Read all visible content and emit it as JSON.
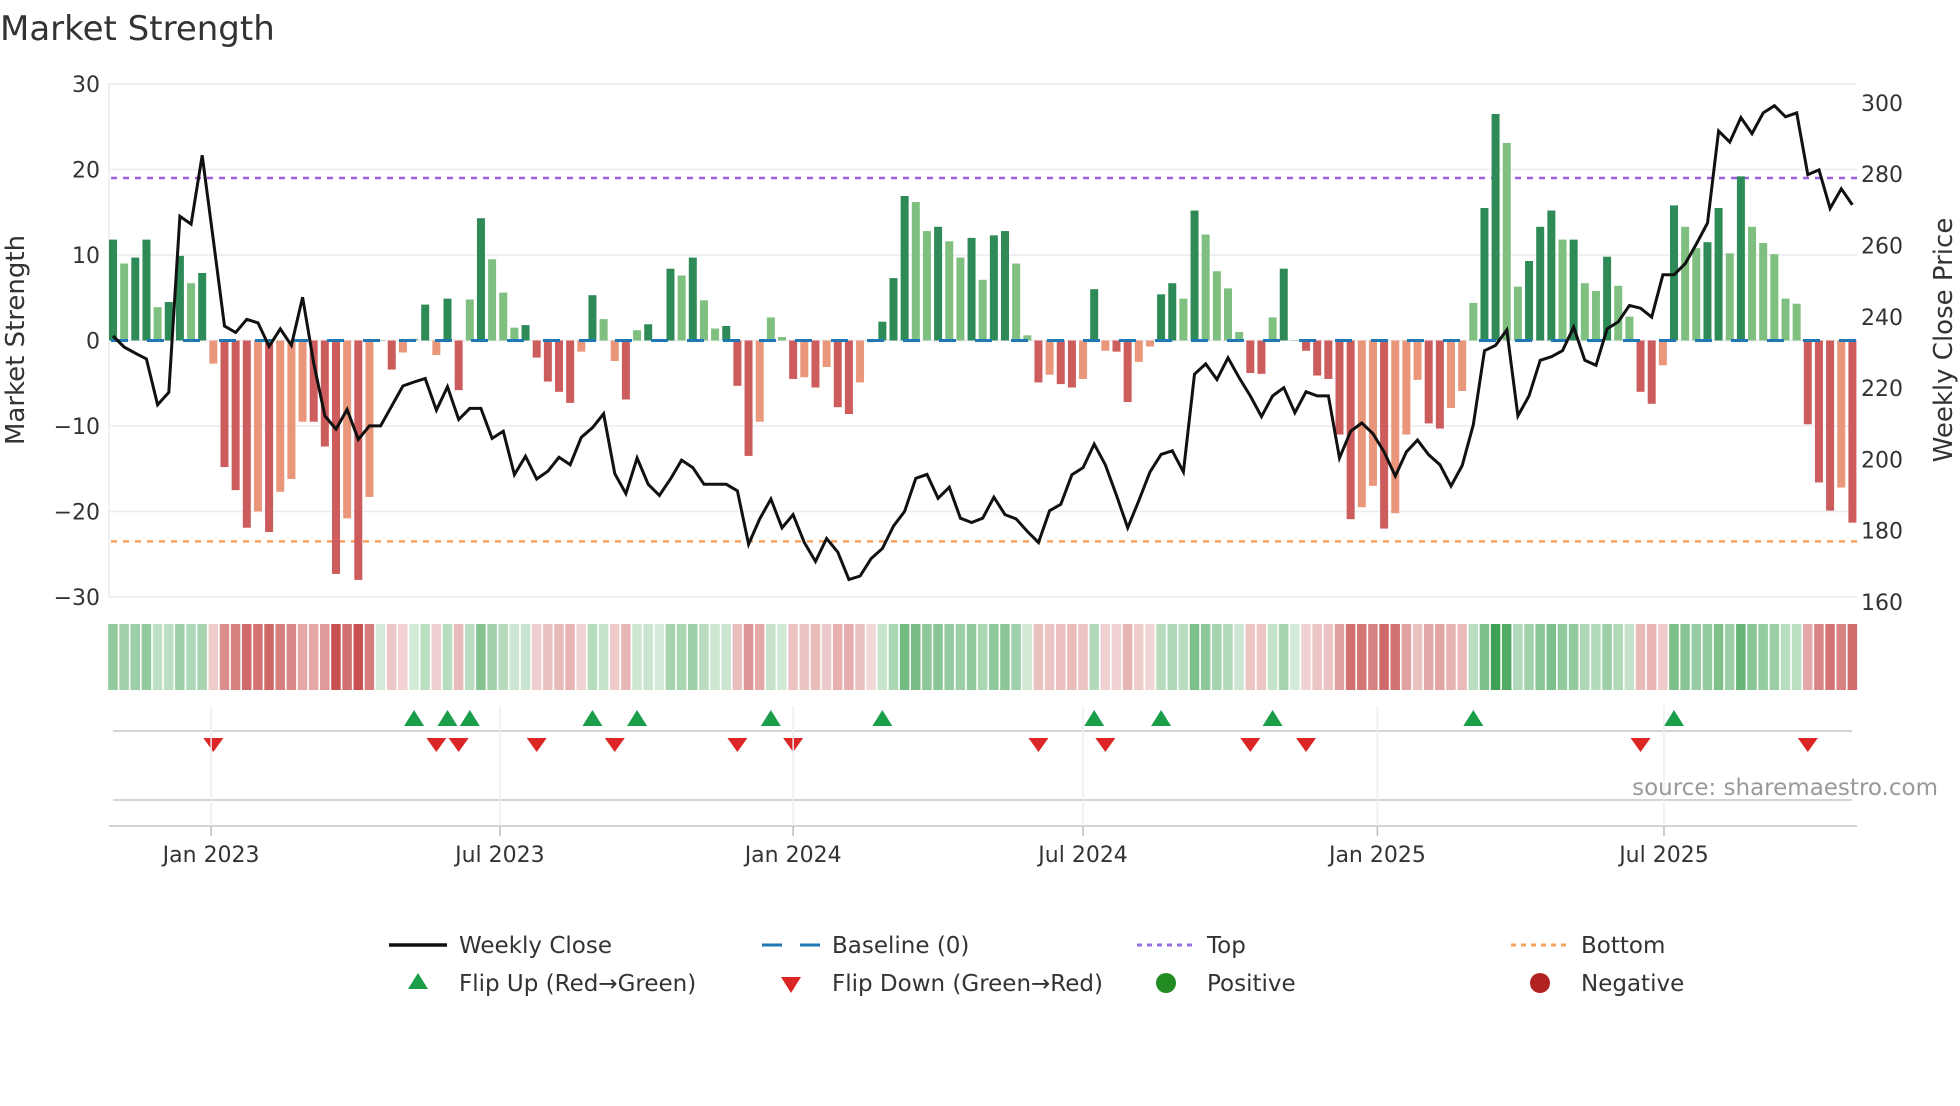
{
  "chart_data": {
    "type": "bar",
    "title": "Market Strength",
    "left_axis": {
      "label": "Market Strength",
      "range": [
        -30,
        30
      ],
      "ticks": [
        30,
        20,
        10,
        0,
        -10,
        -20,
        -30
      ],
      "tick_labels": [
        "30",
        "20",
        "10",
        "0",
        "−10",
        "−20",
        "−30"
      ]
    },
    "right_axis": {
      "label": "Weekly Close Price",
      "range": [
        161.4,
        305.3
      ],
      "ticks": [
        300,
        280,
        260,
        240,
        220,
        200,
        180,
        160
      ],
      "tick_labels": [
        "300",
        "280",
        "260",
        "240",
        "220",
        "200",
        "180",
        "160"
      ]
    },
    "x_ticks": [
      {
        "label": "Jan 2023",
        "week": 8.8
      },
      {
        "label": "Jul 2023",
        "week": 34.7
      },
      {
        "label": "Jan 2024",
        "week": 61.0
      },
      {
        "label": "Jul 2024",
        "week": 87.0
      },
      {
        "label": "Jan 2025",
        "week": 113.4
      },
      {
        "label": "Jul 2025",
        "week": 139.1
      }
    ],
    "top_level": 19,
    "bottom_level": -23.5,
    "baseline": 0,
    "strength": [
      11.8,
      9,
      9.7,
      11.8,
      3.9,
      4.5,
      9.9,
      6.7,
      7.9,
      -2.7,
      -14.8,
      -17.5,
      -21.9,
      -20,
      -22.4,
      -17.7,
      -16.2,
      -9.5,
      -9.5,
      -12.4,
      -27.3,
      -20.8,
      -28,
      -18.3,
      0,
      -3.4,
      -1.4,
      0.2,
      4.2,
      -1.7,
      4.9,
      -5.8,
      4.8,
      14.3,
      9.5,
      5.6,
      1.5,
      1.8,
      -2,
      -4.8,
      -6,
      -7.3,
      -1.3,
      5.3,
      2.5,
      -2.4,
      -6.9,
      1.2,
      1.9,
      0,
      8.4,
      7.6,
      9.7,
      4.7,
      1.4,
      1.7,
      -5.3,
      -13.5,
      -9.5,
      2.7,
      0.4,
      -4.5,
      -4.3,
      -5.5,
      -3.1,
      -7.8,
      -8.6,
      -4.9,
      -0.2,
      2.2,
      7.3,
      16.9,
      16.2,
      12.8,
      13.3,
      11.6,
      9.7,
      12,
      7.1,
      12.3,
      12.8,
      9,
      0.6,
      -4.9,
      -4,
      -5.1,
      -5.5,
      -4.5,
      6,
      -1.2,
      -1.3,
      -7.2,
      -2.5,
      -0.7,
      5.4,
      6.7,
      4.9,
      15.2,
      12.4,
      8.1,
      6.1,
      1,
      -3.8,
      -3.9,
      2.7,
      8.4,
      0,
      -1.2,
      -4.1,
      -4.5,
      -11,
      -20.9,
      -19.5,
      -17,
      -22,
      -20.2,
      -11,
      -4.6,
      -9.7,
      -10.3,
      -7.9,
      -5.9,
      4.4,
      15.5,
      26.5,
      23.1,
      6.3,
      9.3,
      13.3,
      15.2,
      11.8,
      11.8,
      6.7,
      5.8,
      9.8,
      6.4,
      2.8,
      -6,
      -7.4,
      -2.9,
      15.8,
      13.3,
      10.8,
      11.5,
      15.5,
      10.2,
      19.2,
      13.3,
      11.4,
      10.1,
      4.9,
      4.3,
      -9.8,
      -16.6,
      -19.9,
      -17.2,
      -21.3
    ],
    "weekly_close": [
      234.6,
      231.5,
      229.8,
      228.2,
      215.3,
      218.8,
      268.2,
      266,
      285.3,
      261.4,
      237.4,
      235.6,
      239.3,
      238.3,
      231.7,
      236.6,
      232,
      245.5,
      227,
      212.2,
      208.5,
      214,
      205.6,
      209.4,
      209.4,
      215,
      220.6,
      221.7,
      222.7,
      213.8,
      220.4,
      211.2,
      214.3,
      214.3,
      205.9,
      207.9,
      195.7,
      200.9,
      194.5,
      196.7,
      200.6,
      198.5,
      206.2,
      208.9,
      212.8,
      196,
      190.4,
      200.4,
      193,
      189.9,
      194.5,
      199.8,
      197.7,
      193,
      193,
      193,
      191.2,
      176.2,
      183.3,
      188.9,
      180.8,
      184.5,
      176.7,
      171.4,
      177.8,
      174,
      166.3,
      167.3,
      172.2,
      175,
      181.3,
      185.4,
      194.7,
      195.8,
      189.1,
      192.2,
      183.5,
      182.3,
      183.5,
      189.4,
      184.5,
      183.3,
      179.8,
      176.7,
      185.6,
      187.4,
      195.7,
      197.7,
      204.3,
      198.5,
      189.9,
      180.8,
      188.4,
      196.5,
      201.4,
      202.4,
      196.5,
      223.9,
      226.8,
      222.4,
      228.5,
      222.9,
      217.8,
      212,
      217.8,
      220.1,
      213.1,
      219,
      217.8,
      217.8,
      200.4,
      207.9,
      210.2,
      207.2,
      202.1,
      195.3,
      202.1,
      205.4,
      201.3,
      198.5,
      192.5,
      198.3,
      209.7,
      230.5,
      232,
      236.3,
      212.2,
      217.8,
      227.8,
      228.8,
      230.5,
      237.1,
      227.8,
      226.4,
      236.6,
      238.6,
      243.2,
      242.4,
      239.9,
      251.8,
      251.8,
      254.9,
      260.4,
      266.3,
      292.1,
      289,
      295.9,
      291.4,
      297.2,
      299.2,
      296.1,
      297.2,
      279.9,
      281.2,
      270.4,
      275.9,
      271.4
    ],
    "legend": [
      {
        "label": "Weekly Close",
        "kind": "line",
        "color": "#111111"
      },
      {
        "label": "Baseline (0)",
        "kind": "dash",
        "color": "#1f77b4"
      },
      {
        "label": "Top",
        "kind": "dot",
        "color": "#9370db"
      },
      {
        "label": "Bottom",
        "kind": "dot",
        "color": "#f4a460"
      },
      {
        "label": "Flip Up (Red→Green)",
        "kind": "tri-up",
        "color": "#1a9e4a"
      },
      {
        "label": "Flip Down (Green→Red)",
        "kind": "tri-down",
        "color": "#dc2626"
      },
      {
        "label": "Positive",
        "kind": "dot-marker",
        "color": "#228b22"
      },
      {
        "label": "Negative",
        "kind": "dot-marker",
        "color": "#b22222"
      }
    ],
    "legend_position": "bottom",
    "grid": true
  },
  "colors": {
    "pos_rising": "#2e8b57",
    "pos_falling": "#7fbf7f",
    "neg_rising": "#cd5c5c",
    "neg_falling": "#e9967a",
    "heat_pos": "#3ca050",
    "heat_neg": "#c85050",
    "flip_up": "#1a9e4a",
    "flip_down": "#dc2626"
  },
  "source": "source: sharemaestro.com"
}
